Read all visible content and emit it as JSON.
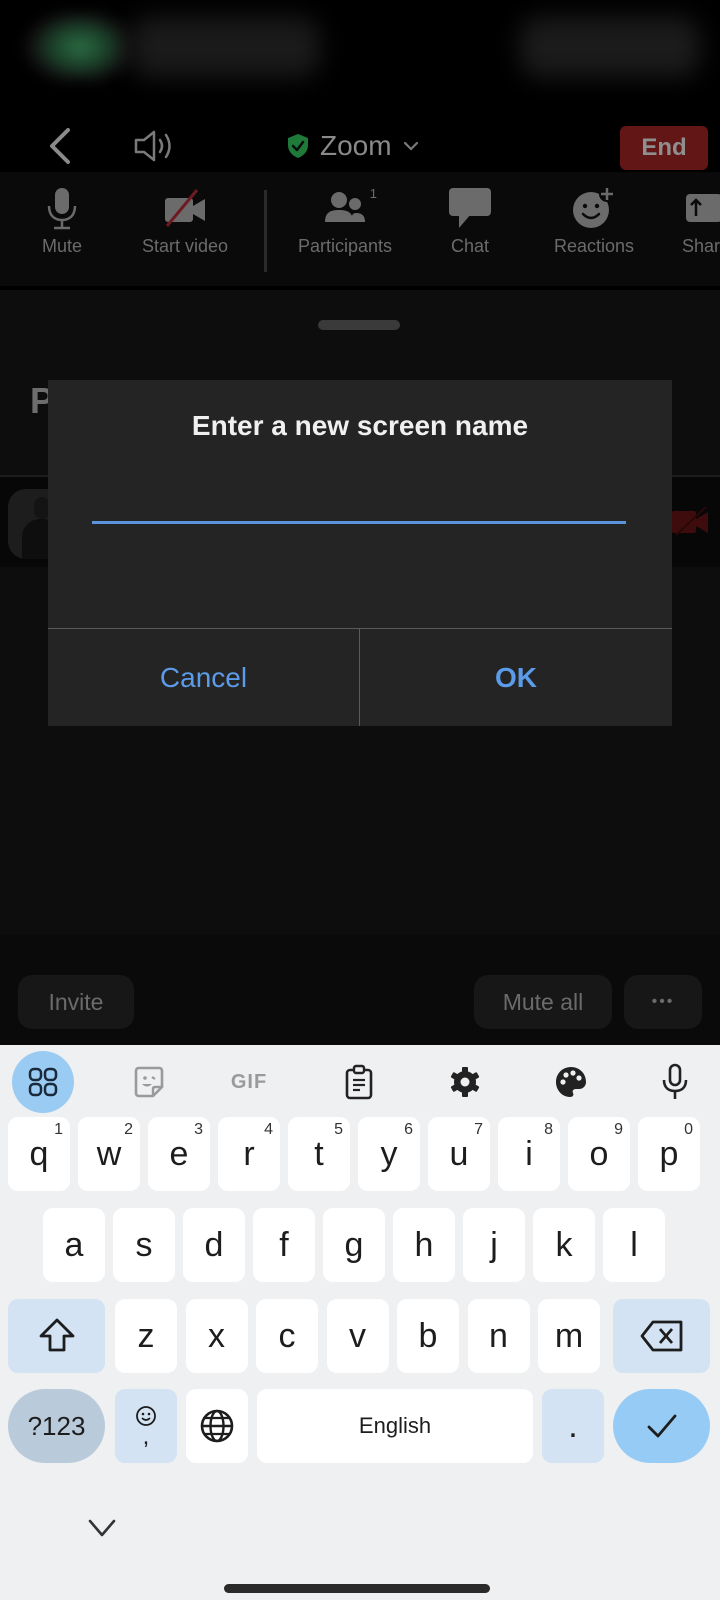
{
  "header": {
    "title": "Zoom",
    "end_label": "End"
  },
  "toolbar": {
    "items": [
      {
        "label": "Mute",
        "icon": "microphone-icon"
      },
      {
        "label": "Start video",
        "icon": "video-off-icon"
      },
      {
        "label": "Participants",
        "icon": "participants-icon",
        "badge": "1"
      },
      {
        "label": "Chat",
        "icon": "chat-icon"
      },
      {
        "label": "Reactions",
        "icon": "reactions-icon"
      },
      {
        "label": "Share",
        "icon": "share-icon"
      }
    ]
  },
  "sheet": {
    "title_fragment": "P"
  },
  "bottom_bar": {
    "invite_label": "Invite",
    "mute_all_label": "Mute all",
    "more_label": "•••"
  },
  "dialog": {
    "title": "Enter a new screen name",
    "input_value": "",
    "cancel_label": "Cancel",
    "ok_label": "OK"
  },
  "keyboard": {
    "toolbar_icons": [
      "apps-grid-icon",
      "sticker-icon",
      "gif-icon",
      "clipboard-icon",
      "settings-icon",
      "palette-icon",
      "microphone-icon"
    ],
    "gif_label": "GIF",
    "row1": [
      {
        "key": "q",
        "hint": "1"
      },
      {
        "key": "w",
        "hint": "2"
      },
      {
        "key": "e",
        "hint": "3"
      },
      {
        "key": "r",
        "hint": "4"
      },
      {
        "key": "t",
        "hint": "5"
      },
      {
        "key": "y",
        "hint": "6"
      },
      {
        "key": "u",
        "hint": "7"
      },
      {
        "key": "i",
        "hint": "8"
      },
      {
        "key": "o",
        "hint": "9"
      },
      {
        "key": "p",
        "hint": "0"
      }
    ],
    "row2": [
      "a",
      "s",
      "d",
      "f",
      "g",
      "h",
      "j",
      "k",
      "l"
    ],
    "row3": [
      "z",
      "x",
      "c",
      "v",
      "b",
      "n",
      "m"
    ],
    "symbols_label": "?123",
    "comma_label": ",",
    "space_label": "English",
    "period_label": "."
  },
  "colors": {
    "accent_blue": "#5b9be8",
    "end_red": "#621616",
    "keyboard_bg": "#eff0f2"
  }
}
